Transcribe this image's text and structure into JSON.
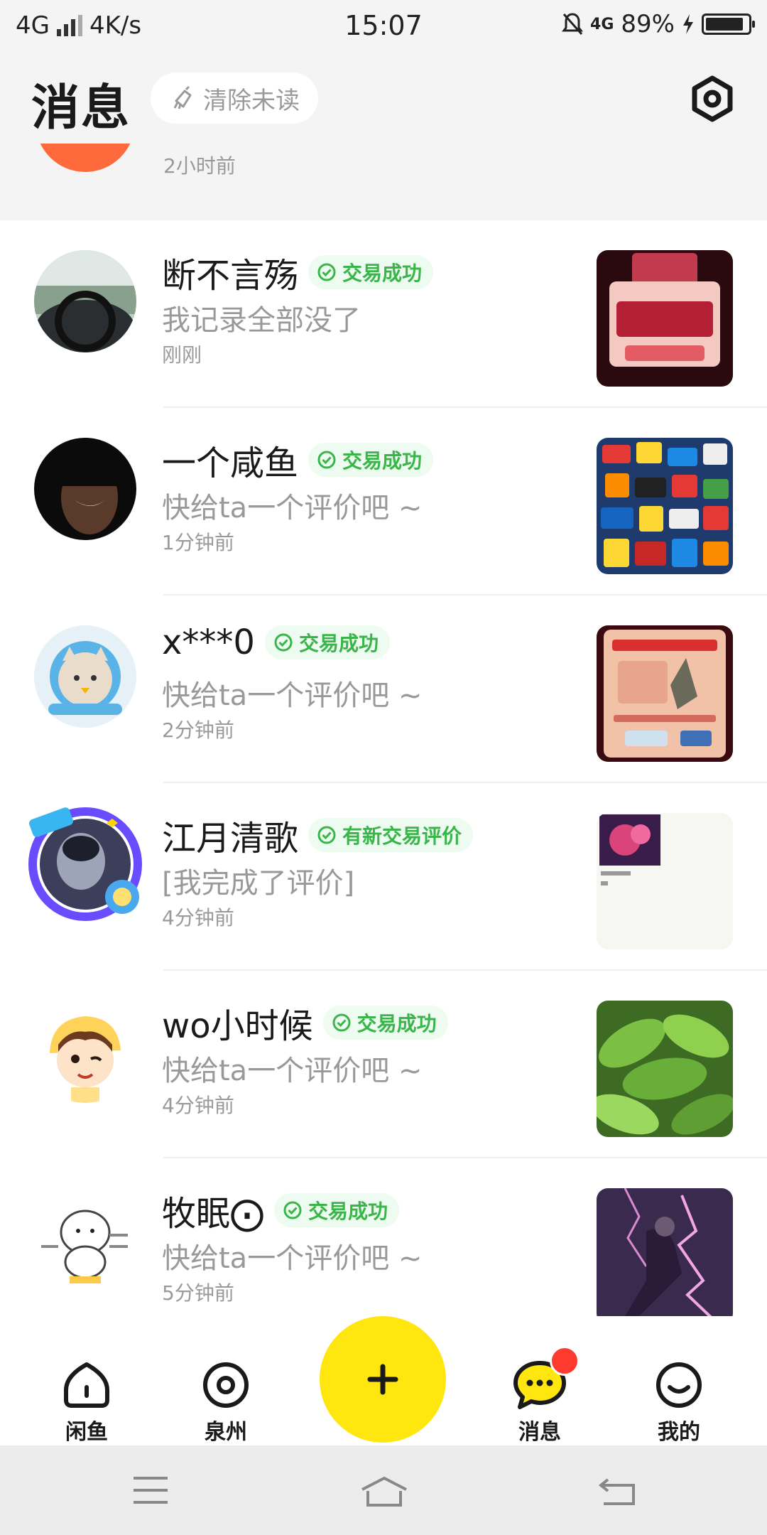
{
  "status_bar": {
    "network": "4G",
    "speed": "4K/s",
    "time": "15:07",
    "lte": "4G",
    "battery": "89%",
    "battery_level": 0.89
  },
  "header": {
    "title": "消息",
    "clear_unread": "清除未读"
  },
  "partial_item": {
    "time": "2小时前"
  },
  "messages": [
    {
      "name": "断不言殇",
      "badge": "交易成功",
      "preview": "我记录全部没了",
      "time": "刚刚"
    },
    {
      "name": "一个咸鱼",
      "badge": "交易成功",
      "preview": "快给ta一个评价吧 ~",
      "time": "1分钟前"
    },
    {
      "name": "x***0",
      "badge": "交易成功",
      "preview": "快给ta一个评价吧 ~",
      "time": "2分钟前"
    },
    {
      "name": "江月清歌",
      "badge": "有新交易评价",
      "preview": "[我完成了评价]",
      "time": "4分钟前"
    },
    {
      "name": "wo小时候",
      "badge": "交易成功",
      "preview": "快给ta一个评价吧 ~",
      "time": "4分钟前"
    },
    {
      "name": "牧眠⨀",
      "badge": "交易成功",
      "preview": "快给ta一个评价吧 ~",
      "time": "5分钟前"
    }
  ],
  "bottom_nav": {
    "home": "闲鱼",
    "location": "泉州",
    "messages": "消息",
    "mine": "我的"
  },
  "colors": {
    "accent_yellow": "#ffe60f",
    "success_green": "#39b54a",
    "badge_red": "#ff3b30"
  }
}
